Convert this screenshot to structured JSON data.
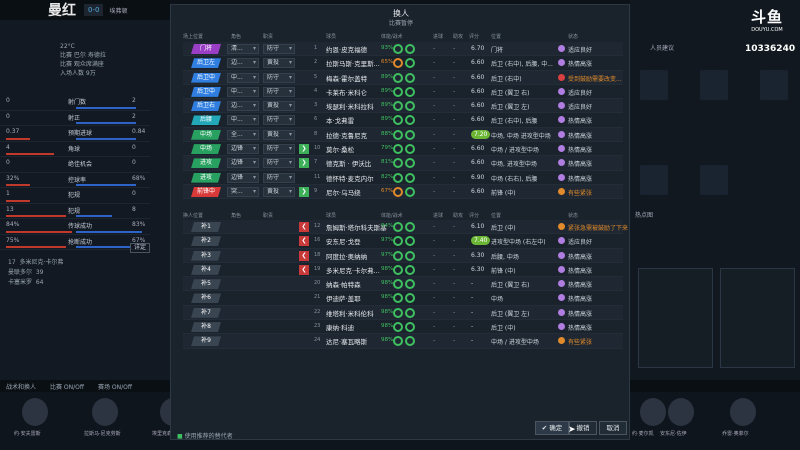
{
  "scoreboard": {
    "team": "曼红",
    "score": "0-0",
    "opponent": "埃弗顿"
  },
  "weather": {
    "temp": "22°C",
    "line2": "比赛 巴尔 寿德拉",
    "line3": "比赛 观众席满座",
    "attendance": "入场人数 9万"
  },
  "stats": [
    {
      "l": "0",
      "m": "射门数",
      "r": "2",
      "bl": 0,
      "br": 50
    },
    {
      "l": "0",
      "m": "射正",
      "r": "2",
      "bl": 0,
      "br": 50
    },
    {
      "l": "0.37",
      "m": "预期进球",
      "r": "0.84",
      "bl": 20,
      "br": 50
    },
    {
      "l": "4",
      "m": "角球",
      "r": "0",
      "bl": 40,
      "br": 0
    },
    {
      "l": "0",
      "m": "绝佳机会",
      "r": "0",
      "bl": 0,
      "br": 0
    },
    {
      "l": "32%",
      "m": "控球率",
      "r": "68%",
      "bl": 20,
      "br": 50
    },
    {
      "l": "1",
      "m": "犯规",
      "r": "0",
      "bl": 20,
      "br": 0
    },
    {
      "l": "13",
      "m": "犯规",
      "r": "8",
      "bl": 50,
      "br": 30
    },
    {
      "l": "84%",
      "m": "传球成功",
      "r": "83%",
      "bl": 55,
      "br": 55
    },
    {
      "l": "75%",
      "m": "抢断成功",
      "r": "67%",
      "bl": 50,
      "br": 45
    }
  ],
  "detail_label": "详定",
  "scorers": {
    "line1a": "17",
    "line1b": "多米尼克·卡尔弗",
    "line2a": "曼联多尔",
    "line2b": "39",
    "line3a": "卡塞米罗",
    "line3b": "64"
  },
  "bottom_bar": {
    "item1": "战术和换人",
    "item2": "比赛 ON/Off",
    "item3": "赛场 ON/Off"
  },
  "bottom_players": [
    "约·安夫雷斯",
    "拉斯马·尼克劳斯",
    "埃里克森",
    "约·麦尔凯",
    "安东尼·佐伊",
    "乔雷·奥菲尔"
  ],
  "right_panel": {
    "title": "人员建议",
    "sub": "热点图",
    "watermark": "斗鱼",
    "watermark_small": "DOUYU.COM",
    "room": "10336240"
  },
  "modal": {
    "title": "换人",
    "subtitle": "比赛暂停",
    "headers1": [
      "场上位置",
      "角色",
      "职责",
      "",
      "球员",
      "体能/战术",
      "进球",
      "助攻",
      "评分",
      "位置",
      "状态"
    ],
    "starters": [
      {
        "pos": "门将",
        "color": "#9b3ec6",
        "role": "清...",
        "duty": "防守",
        "arrow": "",
        "num": "1",
        "name": "约恩·皮克福德",
        "pct": "93%",
        "pcol": "#3fc060",
        "d1": "-",
        "d2": "-",
        "rating": "6.70",
        "pill": false,
        "role2": "门将",
        "dot": "#b07de0",
        "status": "适应良好",
        "scol": "#cfd6de"
      },
      {
        "pos": "后卫左",
        "color": "#2f7ee0",
        "role": "边...",
        "duty": "黄投",
        "arrow": "",
        "num": "2",
        "name": "拉斯马斯·克里斯...",
        "pct": "65%",
        "pcol": "#e08a2c",
        "d1": "-",
        "d2": "-",
        "rating": "6.60",
        "pill": false,
        "role2": "后卫 (右中), 后腰, 中...",
        "dot": "#b07de0",
        "status": "热情高涨",
        "scol": "#cfd6de"
      },
      {
        "pos": "后卫中",
        "color": "#2f7ee0",
        "role": "中...",
        "duty": "防守",
        "arrow": "",
        "num": "5",
        "name": "梅森·霍尔盖特",
        "pct": "89%",
        "pcol": "#3fc060",
        "d1": "-",
        "d2": "-",
        "rating": "6.60",
        "pill": false,
        "role2": "后卫 (右中)",
        "dot": "#d94040",
        "status": "受到鼓励需要改变...",
        "scol": "#e08a2c"
      },
      {
        "pos": "后卫中",
        "color": "#2f7ee0",
        "role": "中...",
        "duty": "防守",
        "arrow": "",
        "num": "4",
        "name": "卡莱布·米科仑",
        "pct": "89%",
        "pcol": "#3fc060",
        "d1": "-",
        "d2": "-",
        "rating": "6.60",
        "pill": false,
        "role2": "后卫 (翼卫 右)",
        "dot": "#b07de0",
        "status": "适应良好",
        "scol": "#cfd6de"
      },
      {
        "pos": "后卫右",
        "color": "#2f7ee0",
        "role": "边...",
        "duty": "黄投",
        "arrow": "",
        "num": "3",
        "name": "埃瑟利·米科拉科",
        "pct": "89%",
        "pcol": "#3fc060",
        "d1": "-",
        "d2": "-",
        "rating": "6.60",
        "pill": false,
        "role2": "后卫 (翼卫 左)",
        "dot": "#b07de0",
        "status": "适应良好",
        "scol": "#cfd6de"
      },
      {
        "pos": "后腰",
        "color": "#22a8b8",
        "role": "中...",
        "duty": "防守",
        "arrow": "",
        "num": "6",
        "name": "本·戈弗雷",
        "pct": "89%",
        "pcol": "#3fc060",
        "d1": "-",
        "d2": "-",
        "rating": "6.60",
        "pill": false,
        "role2": "后卫 (右中), 后腰",
        "dot": "#b07de0",
        "status": "热情高涨",
        "scol": "#cfd6de"
      },
      {
        "pos": "中场",
        "color": "#28a060",
        "role": "全...",
        "duty": "黄投",
        "arrow": "",
        "num": "8",
        "name": "拉德·克鲁尼克",
        "pct": "88%",
        "pcol": "#3fc060",
        "d1": "-",
        "d2": "-",
        "rating": "7.20",
        "pill": true,
        "role2": "中场, 中场 进攻型中场",
        "dot": "#b07de0",
        "status": "热情高涨",
        "scol": "#cfd6de"
      },
      {
        "pos": "中场",
        "color": "#28a060",
        "role": "边锋",
        "duty": "防守",
        "arrow": "green",
        "num": "10",
        "name": "莫尔·桑松",
        "pct": "79%",
        "pcol": "#3fc060",
        "d1": "-",
        "d2": "-",
        "rating": "6.60",
        "pill": false,
        "role2": "中场 / 进攻型中场",
        "dot": "#b07de0",
        "status": "热情高涨",
        "scol": "#cfd6de"
      },
      {
        "pos": "进攻",
        "color": "#28a060",
        "role": "边锋",
        "duty": "防守",
        "arrow": "green",
        "num": "7",
        "name": "德克斯 · 伊沃比",
        "pct": "81%",
        "pcol": "#3fc060",
        "d1": "-",
        "d2": "-",
        "rating": "6.60",
        "pill": false,
        "role2": "中场, 进攻型中场",
        "dot": "#b07de0",
        "status": "热情高涨",
        "scol": "#cfd6de"
      },
      {
        "pos": "进攻",
        "color": "#28a060",
        "role": "边锋",
        "duty": "防守",
        "arrow": "",
        "num": "11",
        "name": "德怀特·麦克内尔",
        "pct": "82%",
        "pcol": "#3fc060",
        "d1": "-",
        "d2": "-",
        "rating": "6.90",
        "pill": false,
        "role2": "中场 (右右), 后腰",
        "dot": "#b07de0",
        "status": "热情高涨",
        "scol": "#cfd6de"
      },
      {
        "pos": "前锋中",
        "color": "#d83a3a",
        "role": "突...",
        "duty": "黄投",
        "arrow": "green",
        "num": "9",
        "name": "尼尔·乌马绕",
        "pct": "67%",
        "pcol": "#e08a2c",
        "d1": "-",
        "d2": "-",
        "rating": "6.60",
        "pill": false,
        "role2": "前锋 (中)",
        "dot": "#e08a2c",
        "status": "有些紧张",
        "scol": "#e08a2c"
      }
    ],
    "headers2": [
      "换人位置",
      "角色",
      "职责",
      "",
      "球员",
      "体能/战术",
      "进球",
      "助攻",
      "评分",
      "位置",
      "状态"
    ],
    "subs": [
      {
        "pos": "补1",
        "arrow": "red",
        "num": "12",
        "name": "詹姆斯·塔尔科夫斯基",
        "pct": "94%",
        "d1": "-",
        "d2": "-",
        "rating": "6.10",
        "pill": false,
        "role2": "后卫 (中)",
        "dot": "#e08a2c",
        "status": "紧张急需被鼓励了下来",
        "scol": "#e08a2c"
      },
      {
        "pos": "补2",
        "arrow": "red",
        "num": "16",
        "name": "安东尼·戈登",
        "pct": "97%",
        "d1": "-",
        "d2": "-",
        "rating": "7.40",
        "pill": true,
        "role2": "进攻型中场 (右左中)",
        "dot": "#b07de0",
        "status": "适应良好",
        "scol": "#cfd6de"
      },
      {
        "pos": "补3",
        "arrow": "red",
        "num": "18",
        "name": "阿度拉·奥纳纳",
        "pct": "97%",
        "d1": "-",
        "d2": "-",
        "rating": "6.30",
        "pill": false,
        "role2": "后腰, 中场",
        "dot": "#b07de0",
        "status": "热情高涨",
        "scol": "#cfd6de"
      },
      {
        "pos": "补4",
        "arrow": "red",
        "num": "19",
        "name": "多米尼克·卡尔弗...",
        "pct": "98%",
        "d1": "-",
        "d2": "-",
        "rating": "6.30",
        "pill": false,
        "role2": "前锋 (中)",
        "dot": "#b07de0",
        "status": "热情高涨",
        "scol": "#cfd6de"
      },
      {
        "pos": "补5",
        "arrow": "",
        "num": "20",
        "name": "纳森·帕特森",
        "pct": "98%",
        "d1": "-",
        "d2": "-",
        "rating": "-",
        "pill": false,
        "role2": "后卫 (翼卫 右)",
        "dot": "#b07de0",
        "status": "热情高涨",
        "scol": "#cfd6de"
      },
      {
        "pos": "补6",
        "arrow": "",
        "num": "21",
        "name": "伊迪萨·盖耶",
        "pct": "98%",
        "d1": "-",
        "d2": "-",
        "rating": "-",
        "pill": false,
        "role2": "中场",
        "dot": "#b07de0",
        "status": "热情高涨",
        "scol": "#cfd6de"
      },
      {
        "pos": "补7",
        "arrow": "",
        "num": "22",
        "name": "维塔利·米科伦科",
        "pct": "98%",
        "d1": "-",
        "d2": "-",
        "rating": "-",
        "pill": false,
        "role2": "后卫 (翼卫 左)",
        "dot": "#b07de0",
        "status": "热情高涨",
        "scol": "#cfd6de"
      },
      {
        "pos": "补8",
        "arrow": "",
        "num": "23",
        "name": "康纳·科迪",
        "pct": "98%",
        "d1": "-",
        "d2": "-",
        "rating": "-",
        "pill": false,
        "role2": "后卫 (中)",
        "dot": "#b07de0",
        "status": "热情高涨",
        "scol": "#cfd6de"
      },
      {
        "pos": "补9",
        "arrow": "",
        "num": "24",
        "name": "达尼·塞瓦略斯",
        "pct": "98%",
        "d1": "-",
        "d2": "-",
        "rating": "-",
        "pill": false,
        "role2": "中场 / 进攻型中场",
        "dot": "#e08a2c",
        "status": "有些紧张",
        "scol": "#e08a2c"
      }
    ],
    "footer_check": "使用推荐的替代者",
    "btn_confirm": "确定",
    "btn_cancel_sub": "撤销",
    "btn_cancel": "取消"
  }
}
